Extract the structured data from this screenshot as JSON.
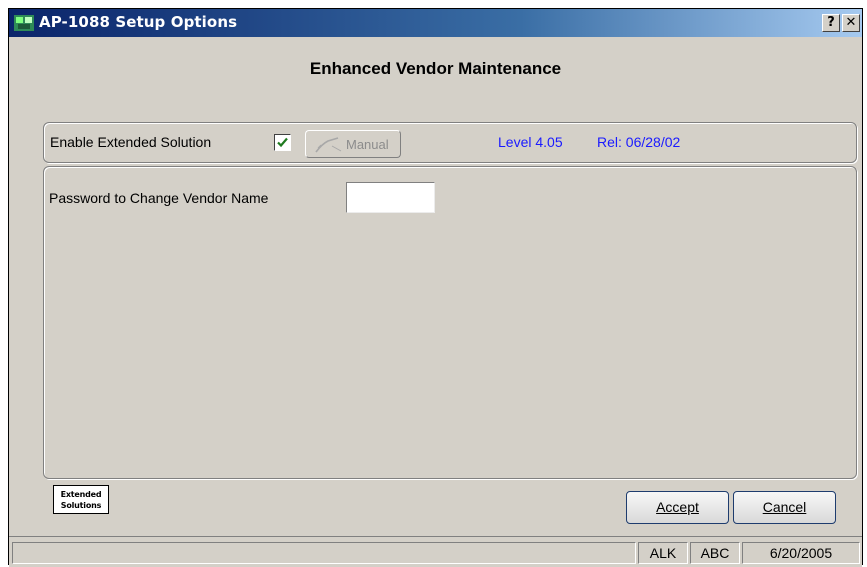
{
  "window": {
    "title": "AP-1088 Setup Options",
    "help_button": "?",
    "close_button": "✕"
  },
  "heading": "Enhanced Vendor Maintenance",
  "extended": {
    "enable_label": "Enable Extended Solution",
    "enabled": true,
    "manual_label": "Manual",
    "level": "Level 4.05",
    "release": "Rel: 06/28/02"
  },
  "password": {
    "label": "Password to Change Vendor Name",
    "value": ""
  },
  "logo": {
    "line1": "Extended",
    "line2": "Solutions"
  },
  "buttons": {
    "accept": "Accept",
    "cancel": "Cancel"
  },
  "statusbar": {
    "user": "ALK",
    "company": "ABC",
    "date": "6/20/2005"
  },
  "icons": {
    "app": "app-icon",
    "check": "checkmark-icon",
    "manual": "pen-icon"
  },
  "colors": {
    "titlebar": "#0a246a",
    "info_text": "#1a1aff",
    "checkmark": "#1f7a1f"
  }
}
